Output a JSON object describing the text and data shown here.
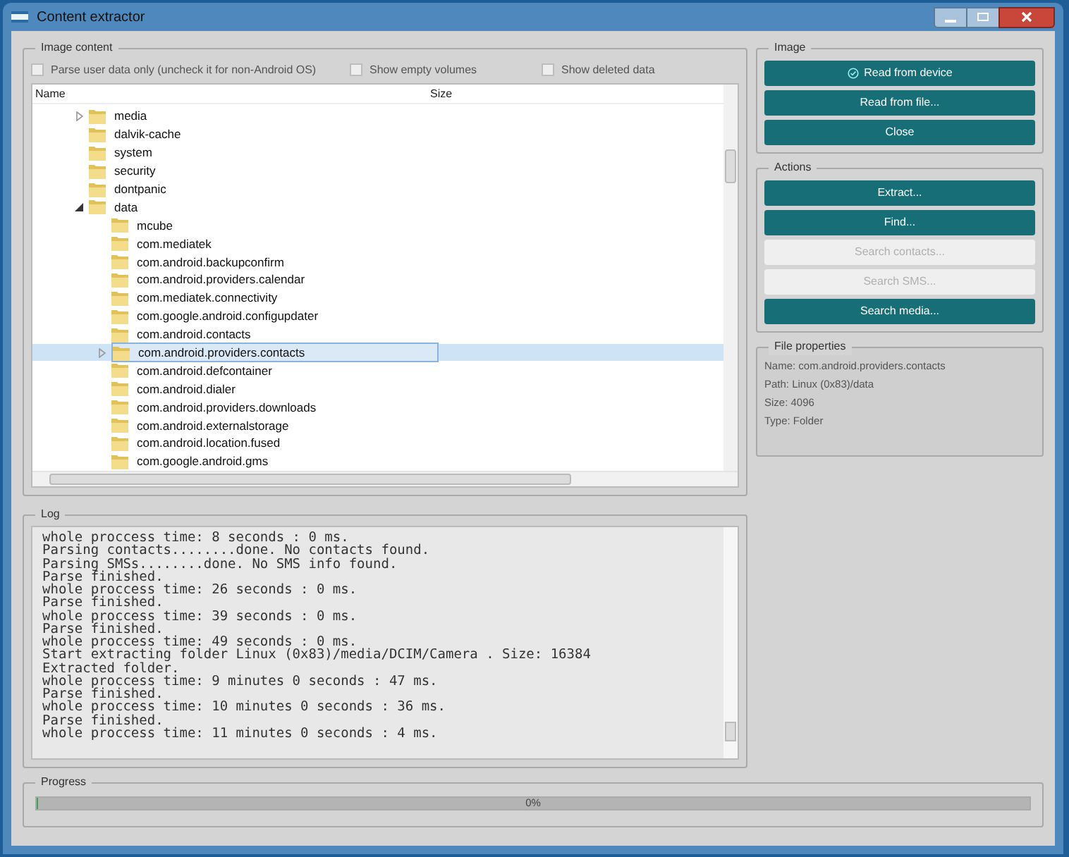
{
  "window": {
    "title": "Content extractor"
  },
  "image_content": {
    "title": "Image content",
    "options": [
      {
        "label": "Parse user data only (uncheck it for non-Android OS)",
        "checked": false
      },
      {
        "label": "Show empty volumes",
        "checked": false
      },
      {
        "label": "Show deleted data",
        "checked": false
      }
    ],
    "columns": [
      "Name",
      "Size"
    ],
    "tree": [
      {
        "name": "media",
        "expanded": false,
        "selected": false
      },
      {
        "name": "dalvik-cache",
        "selected": false
      },
      {
        "name": "system",
        "selected": false
      },
      {
        "name": "security",
        "selected": false
      },
      {
        "name": "dontpanic",
        "selected": false
      },
      {
        "name": "data",
        "expanded": true,
        "selected": false,
        "children": [
          {
            "name": "mcube",
            "selected": false
          },
          {
            "name": "com.mediatek",
            "selected": false
          },
          {
            "name": "com.android.backupconfirm",
            "selected": false
          },
          {
            "name": "com.android.providers.calendar",
            "selected": false
          },
          {
            "name": "com.mediatek.connectivity",
            "selected": false
          },
          {
            "name": "com.google.android.configupdater",
            "selected": false
          },
          {
            "name": "com.android.contacts",
            "selected": false
          },
          {
            "name": "com.android.providers.contacts",
            "expanded": false,
            "selected": true
          },
          {
            "name": "com.android.defcontainer",
            "selected": false
          },
          {
            "name": "com.android.dialer",
            "selected": false
          },
          {
            "name": "com.android.providers.downloads",
            "selected": false
          },
          {
            "name": "com.android.externalstorage",
            "selected": false
          },
          {
            "name": "com.android.location.fused",
            "selected": false
          },
          {
            "name": "com.google.android.gms",
            "selected": false
          }
        ]
      }
    ]
  },
  "image": {
    "title": "Image",
    "buttons": [
      {
        "label": "Read from device",
        "checked": true
      },
      {
        "label": "Read from file...",
        "checked": false
      },
      {
        "label": "Close",
        "checked": false
      }
    ]
  },
  "actions": {
    "title": "Actions",
    "buttons": [
      {
        "label": "Extract...",
        "disabled": false
      },
      {
        "label": "Find...",
        "disabled": false
      },
      {
        "label": "Search contacts...",
        "disabled": true
      },
      {
        "label": "Search SMS...",
        "disabled": true
      },
      {
        "label": "Search media...",
        "disabled": false
      }
    ]
  },
  "file_properties": {
    "title": "File properties",
    "lines": [
      "Name: com.android.providers.contacts",
      "Path: Linux (0x83)/data",
      "Size: 4096",
      "Type: Folder"
    ]
  },
  "log": {
    "title": "Log",
    "lines": [
      "whole proccess time: 8 seconds : 0 ms.",
      "Parsing contacts........done. No contacts found.",
      "Parsing SMSs........done. No SMS info found.",
      "Parse finished.",
      "whole proccess time: 26 seconds : 0 ms.",
      "Parse finished.",
      "whole proccess time: 39 seconds : 0 ms.",
      "Parse finished.",
      "whole proccess time: 49 seconds : 0 ms.",
      "Start extracting folder Linux (0x83)/media/DCIM/Camera . Size: 16384",
      "Extracted folder.",
      "whole proccess time: 9 minutes 0 seconds : 47 ms.",
      "Parse finished.",
      "whole proccess time: 10 minutes 0 seconds : 36 ms.",
      "Parse finished.",
      "whole proccess time: 11 minutes 0 seconds : 4 ms."
    ]
  },
  "progress": {
    "title": "Progress",
    "level": 0,
    "text": "0%"
  }
}
